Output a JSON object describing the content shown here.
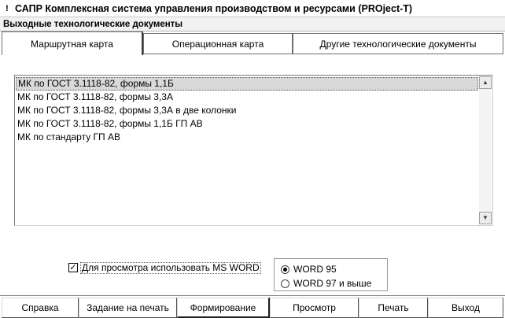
{
  "window": {
    "title": "САПР Комплексная система управления производством и ресурсами  (PROject-T)",
    "icon": "app-icon"
  },
  "section": {
    "title": "Выходные технологические документы"
  },
  "tabs": [
    {
      "label": "Маршрутная карта",
      "active": true
    },
    {
      "label": "Операционная карта",
      "active": false
    },
    {
      "label": "Другие технологические документы",
      "active": false
    }
  ],
  "document_list": {
    "items": [
      "МК по ГОСТ 3.1118-82, формы 1,1Б",
      "МК по ГОСТ 3.1118-82, формы 3,3А",
      "МК по ГОСТ 3.1118-82, формы 3,3А в две колонки",
      "МК по ГОСТ 3.1118-82, формы 1,1Б ГП АВ",
      "МК по стандарту ГП АВ"
    ],
    "selected_index": 0
  },
  "options": {
    "use_ms_word_label": "Для просмотра использовать MS WORD",
    "use_ms_word_checked": true,
    "word_versions": [
      {
        "label": "WORD 95",
        "selected": true
      },
      {
        "label": "WORD 97 и выше",
        "selected": false
      }
    ]
  },
  "buttons": {
    "help": "Справка",
    "print_task": "Задание на печать",
    "generate": "Формирование",
    "preview": "Просмотр",
    "print": "Печать",
    "exit": "Выход"
  },
  "colors": {
    "selection": "#d9d9d9",
    "section_bar": "#f2f2f2"
  }
}
